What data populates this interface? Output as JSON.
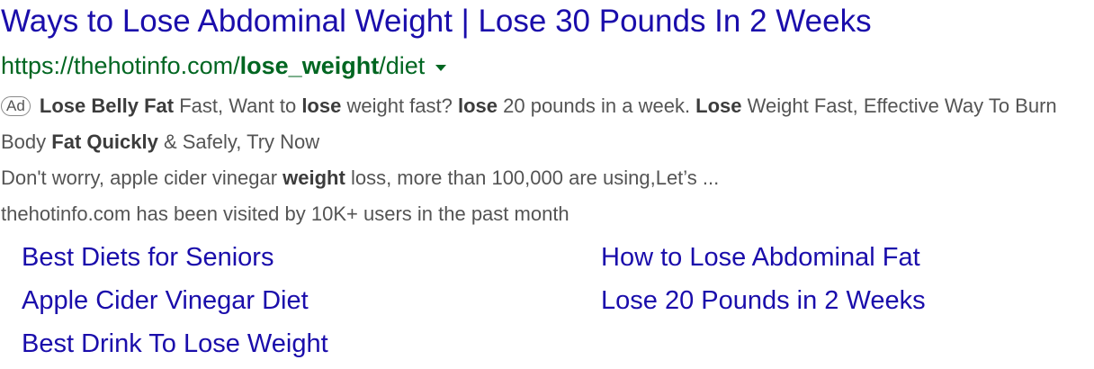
{
  "ad": {
    "title": "Ways to Lose Abdominal Weight | Lose 30 Pounds In 2 Weeks",
    "url": {
      "prefix": "https://thehotinfo.com/",
      "bold": "lose_weight",
      "suffix": "/diet"
    },
    "badge": "Ad",
    "description": {
      "line1": [
        {
          "text": "Lose Belly Fat",
          "bold": true
        },
        {
          "text": " Fast, Want to ",
          "bold": false
        },
        {
          "text": "lose",
          "bold": true
        },
        {
          "text": " weight fast? ",
          "bold": false
        },
        {
          "text": "lose",
          "bold": true
        },
        {
          "text": " 20 pounds in a week. ",
          "bold": false
        },
        {
          "text": "Lose",
          "bold": true
        },
        {
          "text": " Weight Fast, Effective Way To Burn Body ",
          "bold": false
        },
        {
          "text": "Fat Quickly",
          "bold": true
        },
        {
          "text": " & Safely, Try Now",
          "bold": false
        }
      ],
      "line2": [
        {
          "text": "Don't worry, apple cider vinegar ",
          "bold": false
        },
        {
          "text": "weight",
          "bold": true
        },
        {
          "text": " loss, more than 100,000 are using,Let’s ...",
          "bold": false
        }
      ],
      "line3": "thehotinfo.com has been visited by 10K+ users in the past month"
    },
    "sitelinks": [
      {
        "label": "Best Diets for Seniors"
      },
      {
        "label": "How to Lose Abdominal Fat"
      },
      {
        "label": "Apple Cider Vinegar Diet"
      },
      {
        "label": "Lose 20 Pounds in 2 Weeks"
      },
      {
        "label": "Best Drink To Lose Weight"
      }
    ]
  }
}
